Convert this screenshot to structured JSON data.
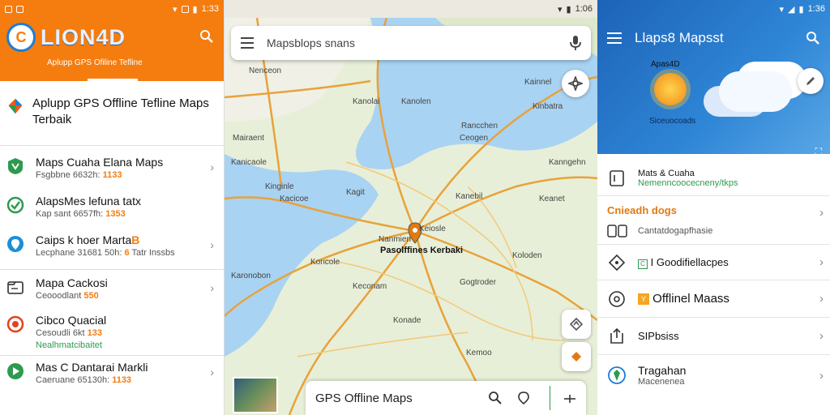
{
  "left": {
    "status": {
      "time": "1:33"
    },
    "header": {
      "logo": "LION4D",
      "logo_badge": "C",
      "subtitle": "Aplupp GPS Ofiline Tefline"
    },
    "title": "Aplupp GPS Offline Tefline Maps  Terbaik",
    "items": [
      {
        "name": "Maps Cuaha Elana Maps",
        "sub": "Fsgbbne 6632h: ",
        "accent": "1133",
        "chevron": true
      },
      {
        "name": "AlapsMes lefuna tatx",
        "sub": "Kap sant 6657fh: ",
        "accent": "1353",
        "chevron": false
      },
      {
        "name": "Caips k hoer Marta",
        "badge": "B",
        "sub": "Lecphane 31681 50h: ",
        "accent": "6",
        "sub2": "Tatr Inssbs",
        "chevron": true
      },
      {
        "name": "Mapa Cackosi",
        "sub": "Ceooodlant ",
        "accent": "550",
        "chevron": true
      },
      {
        "name": "Cibco Quacial",
        "sub": "Cesoudli 6kt ",
        "accent": "133",
        "green": "Nealhmatcibaitet",
        "chevron": false
      },
      {
        "name": "Mas C Dantarai Markli",
        "sub": "Caeruane 65130h: ",
        "accent": "1133",
        "chevron": true
      }
    ]
  },
  "mid": {
    "status": {
      "time": "1:06"
    },
    "search": {
      "placeholder": "Mapsblops snans"
    },
    "bottom_label": "GPS Offline Maps",
    "center_label": "Pasolffines Kerbaki",
    "labels": [
      "Nenceon",
      "Kanolai",
      "Kanolen",
      "Kainnel",
      "Kinbatra",
      "Rancchen",
      "Ceogen",
      "Mairaent",
      "Kanicaole",
      "Kanngehn",
      "Kinginle",
      "Kagit",
      "Kacicoe",
      "Kanebil",
      "Keanet",
      "Keiosle",
      "Nanmien",
      "Koncole",
      "Koloden",
      "Karonobon",
      "Keconam",
      "Gogtroder",
      "Konade",
      "Kemoo"
    ]
  },
  "right": {
    "status": {
      "time": "1:36"
    },
    "toolbar_title": "Llaps8 Mapsst",
    "hero": {
      "brand": "Apas4D",
      "sub": "Siceuocoads"
    },
    "items": [
      {
        "name": "Mats & Cuaha",
        "sub": "Nemenncoocecneny/tkps"
      },
      {
        "section": "Cnieadh dogs",
        "sub": "Cantatdogapfhasie"
      },
      {
        "name": "I Goodifiellacpes",
        "badge": "C"
      },
      {
        "name": "Offlinel Maass",
        "badge": "Y"
      },
      {
        "name": "SIPbsiss"
      },
      {
        "name": "Tragahan",
        "sub": "Macenenea"
      }
    ]
  },
  "colors": {
    "orange": "#f57c0f",
    "blue": "#1a5fb0",
    "green": "#2e9a4f",
    "road": "#e8a23a",
    "water": "#a9d3f2",
    "land": "#e8efd8"
  }
}
